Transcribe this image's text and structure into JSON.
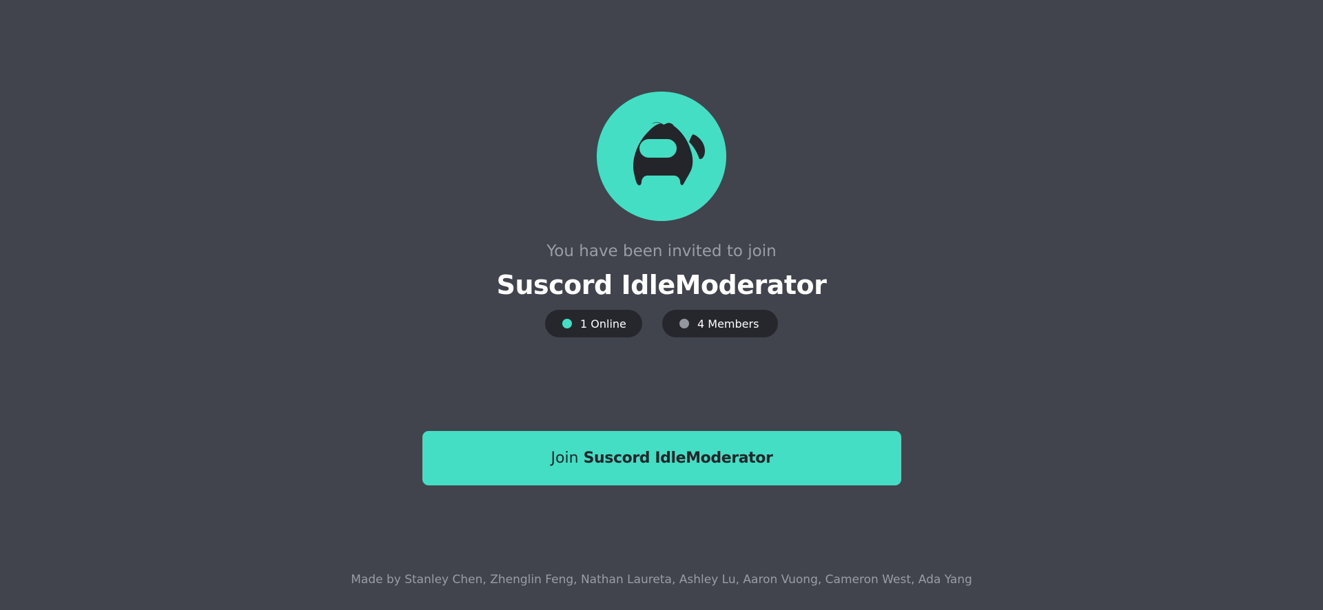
{
  "invite": {
    "subtitle": "You have been invited to join",
    "server_name": "Suscord IdleModerator",
    "server_icon": "suscord-crewmate-icon",
    "stats": {
      "online_label": "1 Online",
      "members_label": "4 Members"
    },
    "join_button": {
      "prefix": "Join",
      "server_name": "Suscord IdleModerator"
    }
  },
  "footer": {
    "credits": "Made by Stanley Chen, Zhenglin Feng, Nathan Laureta, Ashley Lu, Aaron Vuong, Cameron West, Ada Yang"
  },
  "colors": {
    "background": "#41444d",
    "accent": "#43dec3",
    "pill_background": "#25272c",
    "online_dot": "#43dec3",
    "members_dot": "#9496a0",
    "muted_text": "#9a9ca6"
  }
}
